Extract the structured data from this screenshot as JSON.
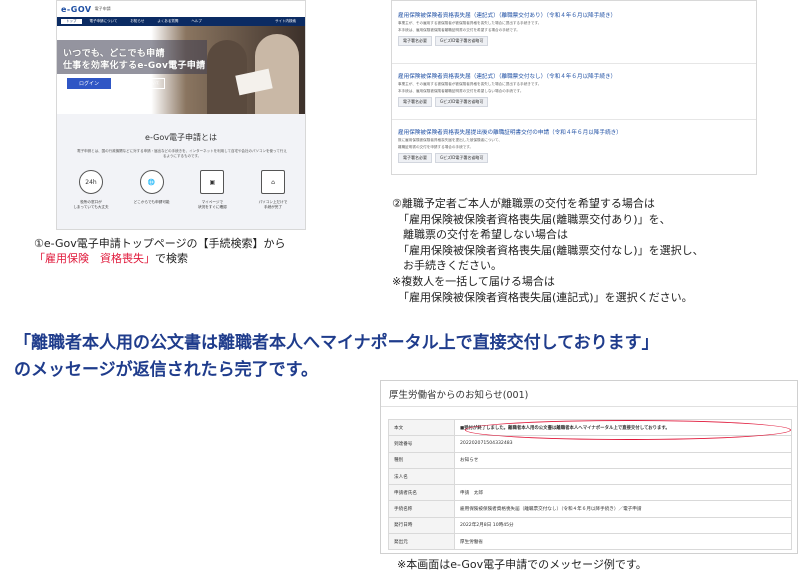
{
  "shot1": {
    "logo": "e-GOV",
    "logo_sub": "電子申請",
    "nav": [
      "トップ",
      "電子申請について",
      "お知らせ",
      "よくある質問",
      "ヘルプ"
    ],
    "nav_util": "サイト内検索",
    "hero_line1": "いつでも、どこでも申請",
    "hero_line2": "仕事を効率化するe-Gov電子申請",
    "login_button": "ログイン",
    "about_button": "e-Gov電子申請について",
    "section_title": "e-Gov電子申請とは",
    "section_desc": "電子申請とは、国の行政機関などに対する申請・届出などの手続きを、インターネットを利用して自宅や会社のパソコンを使って行えるようにするものです。",
    "features": [
      {
        "icon": "24h",
        "label": "役所の窓口が\nしまっていても大丈夫"
      },
      {
        "icon": "🌐",
        "label": "どこからでも申請可能"
      },
      {
        "icon": "▣",
        "label": "マイページで\n状況をすぐに確認"
      },
      {
        "icon": "⌂",
        "label": "パソコン上だけで\n手続が完了"
      }
    ]
  },
  "caption1": {
    "line1": "①e-Gov電子申請トップページの【手続検索】から",
    "line2_red": "「雇用保険　資格喪失」",
    "line2_rest": "で検索"
  },
  "shot2": {
    "procedures": [
      {
        "title": "雇用保険被保険者資格喪失届（連記式）（離職票交付あり）（令和４年６月以降手続き）",
        "desc1": "事業主が、その雇用する被保険者が被保険者資格を喪失した場合に提出する手続きです。",
        "desc2": "本手続は、雇用保険被保険者離職証明書の交付を希望する場合の手続です。",
        "tags": [
          "電子署名必要",
          "GビズID電子署名省略可"
        ]
      },
      {
        "title": "雇用保険被保険者資格喪失届（連記式）（離職票交付なし）（令和４年６月以降手続き）",
        "desc1": "事業主が、その雇用する被保険者が被保険者資格を喪失した場合に提出する手続きです。",
        "desc2": "本手続は、雇用保険被保険者離職証明書の交付を希望しない場合の手続です。",
        "tags": [
          "電子署名必要",
          "GビズID電子署名省略可"
        ]
      },
      {
        "title": "雇用保険被保険者資格喪失届提出後の離職証明書交付の申請（令和４年６月以降手続き）",
        "desc1": "既に雇用保険被保険者資格喪失届を提出した被保険者について、",
        "desc2": "離職証明書の交付を申請する場合の手続です。",
        "tags": [
          "電子署名必要",
          "GビズID電子署名省略可"
        ]
      }
    ]
  },
  "caption2": [
    "②離職予定者ご本人が離職票の交付を希望する場合は",
    "「雇用保険被保険者資格喪失届(離職票交付あり)」を、",
    "離職票の交付を希望しない場合は",
    "「雇用保険被保険者資格喪失届(離職票交付なし)」を選択し、",
    "お手続きください。",
    "※複数人を一括して届ける場合は",
    "「雇用保険被保険者資格喪失届(連記式)」を選択ください。"
  ],
  "big_message": {
    "line1": "「離職者本人用の公文書は離職者本人へマイナポータル上で直接交付しております」",
    "line2": "のメッセージが返信されたら完了です。"
  },
  "shot3": {
    "title": "厚生労働省からのお知らせ(001)",
    "rows": [
      {
        "key": "本文",
        "value": "■受付が終了しました。離職者本人用の公文書は離職者本人へマイナポータル上で直接交付しております。"
      },
      {
        "key": "到達番号",
        "value": "202202071504332483"
      },
      {
        "key": "種別",
        "value": "お知らせ"
      },
      {
        "key": "法人名",
        "value": ""
      },
      {
        "key": "申請者氏名",
        "value": "申請　太郎"
      },
      {
        "key": "手続名称",
        "value": "雇用保険被保険者資格喪失届（離職票交付なし）（令和４年６月以降手続き）／電子申請"
      },
      {
        "key": "発行日時",
        "value": "2022年2月8日 10時45分"
      },
      {
        "key": "発出元",
        "value": "厚生労働省"
      }
    ]
  },
  "caption3": "※本画面はe-Gov電子申請でのメッセージ例です。"
}
